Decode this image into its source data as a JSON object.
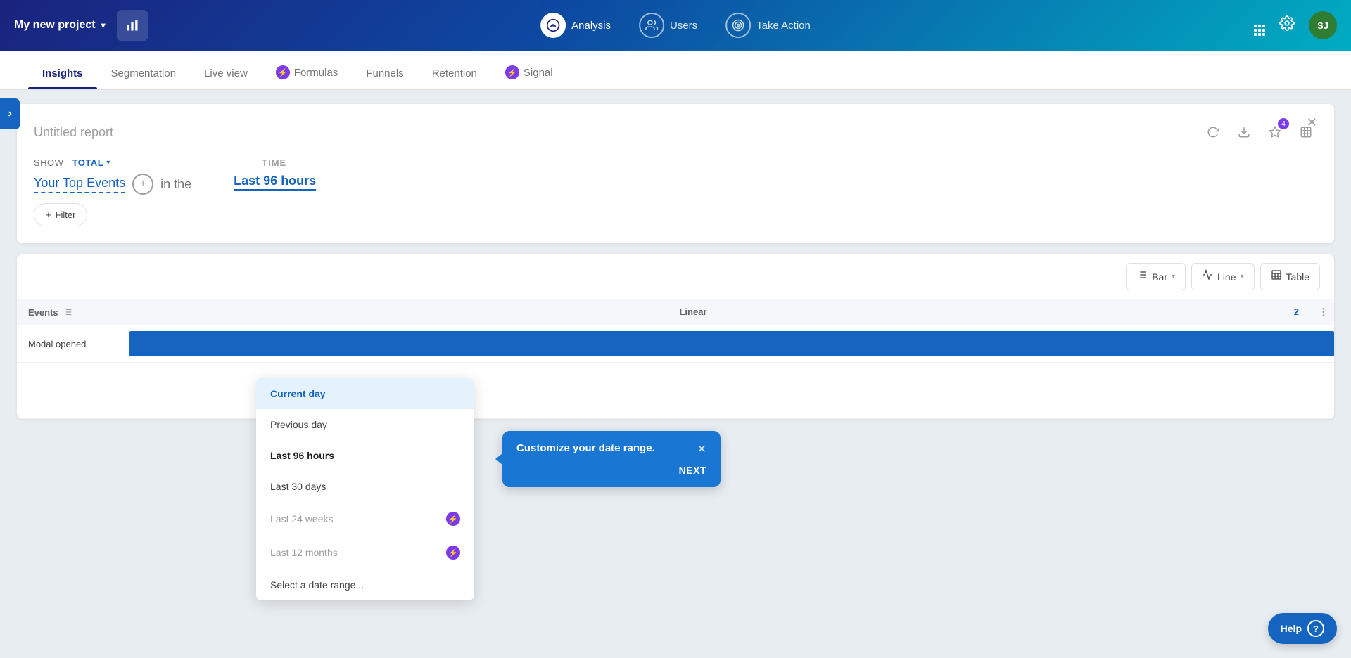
{
  "app": {
    "project_name": "My new project",
    "avatar_text": "SJ"
  },
  "top_nav": {
    "analysis_label": "Analysis",
    "users_label": "Users",
    "take_action_label": "Take Action"
  },
  "sub_nav": {
    "items": [
      {
        "id": "insights",
        "label": "Insights",
        "active": true
      },
      {
        "id": "segmentation",
        "label": "Segmentation",
        "active": false
      },
      {
        "id": "live_view",
        "label": "Live view",
        "active": false
      },
      {
        "id": "formulas",
        "label": "Formulas",
        "active": false,
        "has_icon": true
      },
      {
        "id": "funnels",
        "label": "Funnels",
        "active": false
      },
      {
        "id": "retention",
        "label": "Retention",
        "active": false
      },
      {
        "id": "signal",
        "label": "Signal",
        "active": false,
        "has_icon": true
      }
    ]
  },
  "report": {
    "title": "Untitled report",
    "show_label": "SHOW",
    "total_label": "TOTAL",
    "time_label": "TIME",
    "events_label": "Your Top Events",
    "in_the_label": "in the",
    "selected_time": "Last 96 hours",
    "filter_button": "+ Filter"
  },
  "time_dropdown": {
    "items": [
      {
        "id": "current_day",
        "label": "Current day",
        "active": true,
        "muted": false,
        "bold": false
      },
      {
        "id": "previous_day",
        "label": "Previous day",
        "active": false,
        "muted": false,
        "bold": false
      },
      {
        "id": "last_96_hours",
        "label": "Last 96 hours",
        "active": false,
        "muted": false,
        "bold": true
      },
      {
        "id": "last_30_days",
        "label": "Last 30 days",
        "active": false,
        "muted": false,
        "bold": false
      },
      {
        "id": "last_24_weeks",
        "label": "Last 24 weeks",
        "active": false,
        "muted": true,
        "bold": false,
        "has_icon": true
      },
      {
        "id": "last_12_months",
        "label": "Last 12 months",
        "active": false,
        "muted": true,
        "bold": false,
        "has_icon": true
      },
      {
        "id": "select_date",
        "label": "Select a date range...",
        "active": false,
        "muted": false,
        "bold": false
      }
    ]
  },
  "tooltip": {
    "title": "Customize your date range.",
    "next_label": "NEXT"
  },
  "chart": {
    "bar_label": "Bar",
    "line_label": "Line",
    "table_label": "Table",
    "events_header": "Events",
    "linear_header": "Linear",
    "number_badge": "2",
    "rows": [
      {
        "name": "Modal opened",
        "bar_width_pct": 100
      }
    ]
  },
  "help": {
    "label": "Help",
    "icon": "?"
  }
}
